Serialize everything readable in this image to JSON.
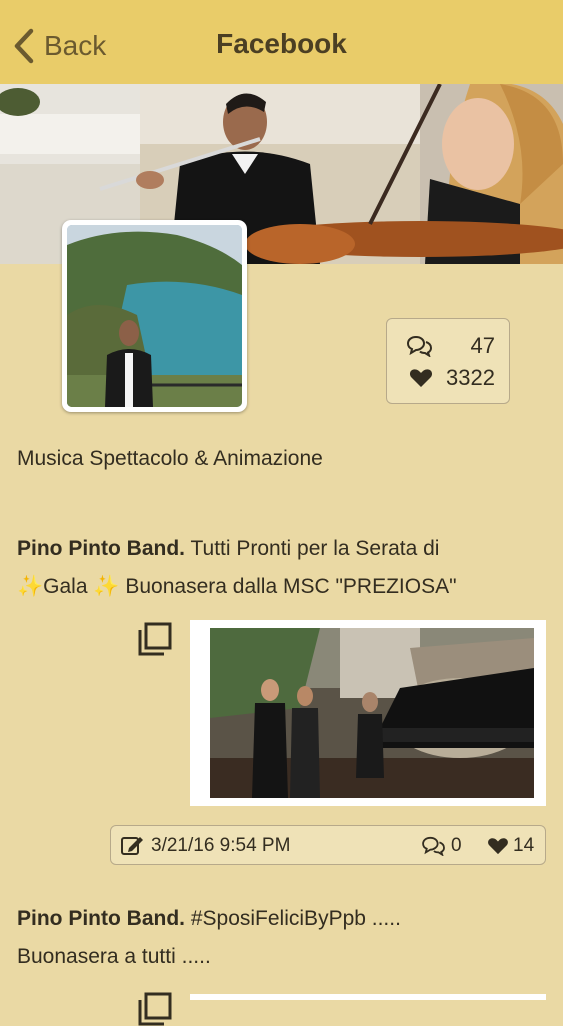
{
  "nav": {
    "back_label": "Back",
    "title": "Facebook"
  },
  "profile": {
    "subtitle": "Musica Spettacolo & Animazione"
  },
  "stats": {
    "comments": "47",
    "likes": "3322"
  },
  "posts": [
    {
      "author": "Pino Pinto Band.",
      "text_line1": "Tutti Pronti per la Serata di",
      "text_line2_a": "Gala",
      "text_line2_b": "Buonasera dalla MSC \"PREZIOSA\"",
      "sparkle": "✨",
      "date": "3/21/16 9:54 PM",
      "comments": "0",
      "likes": "14"
    },
    {
      "author": "Pino Pinto Band.",
      "text_line1": "#SposiFeliciByPpb .....",
      "text_line2": "Buonasera a tutti ....."
    }
  ],
  "colors": {
    "header": "#e9cc69",
    "background": "#ead9a4",
    "accent": "#6b5a2f",
    "sparkle": "#e8c24a"
  },
  "icons": [
    "chevron-left-icon",
    "comment-icon",
    "heart-icon",
    "gallery-icon",
    "edit-icon"
  ]
}
